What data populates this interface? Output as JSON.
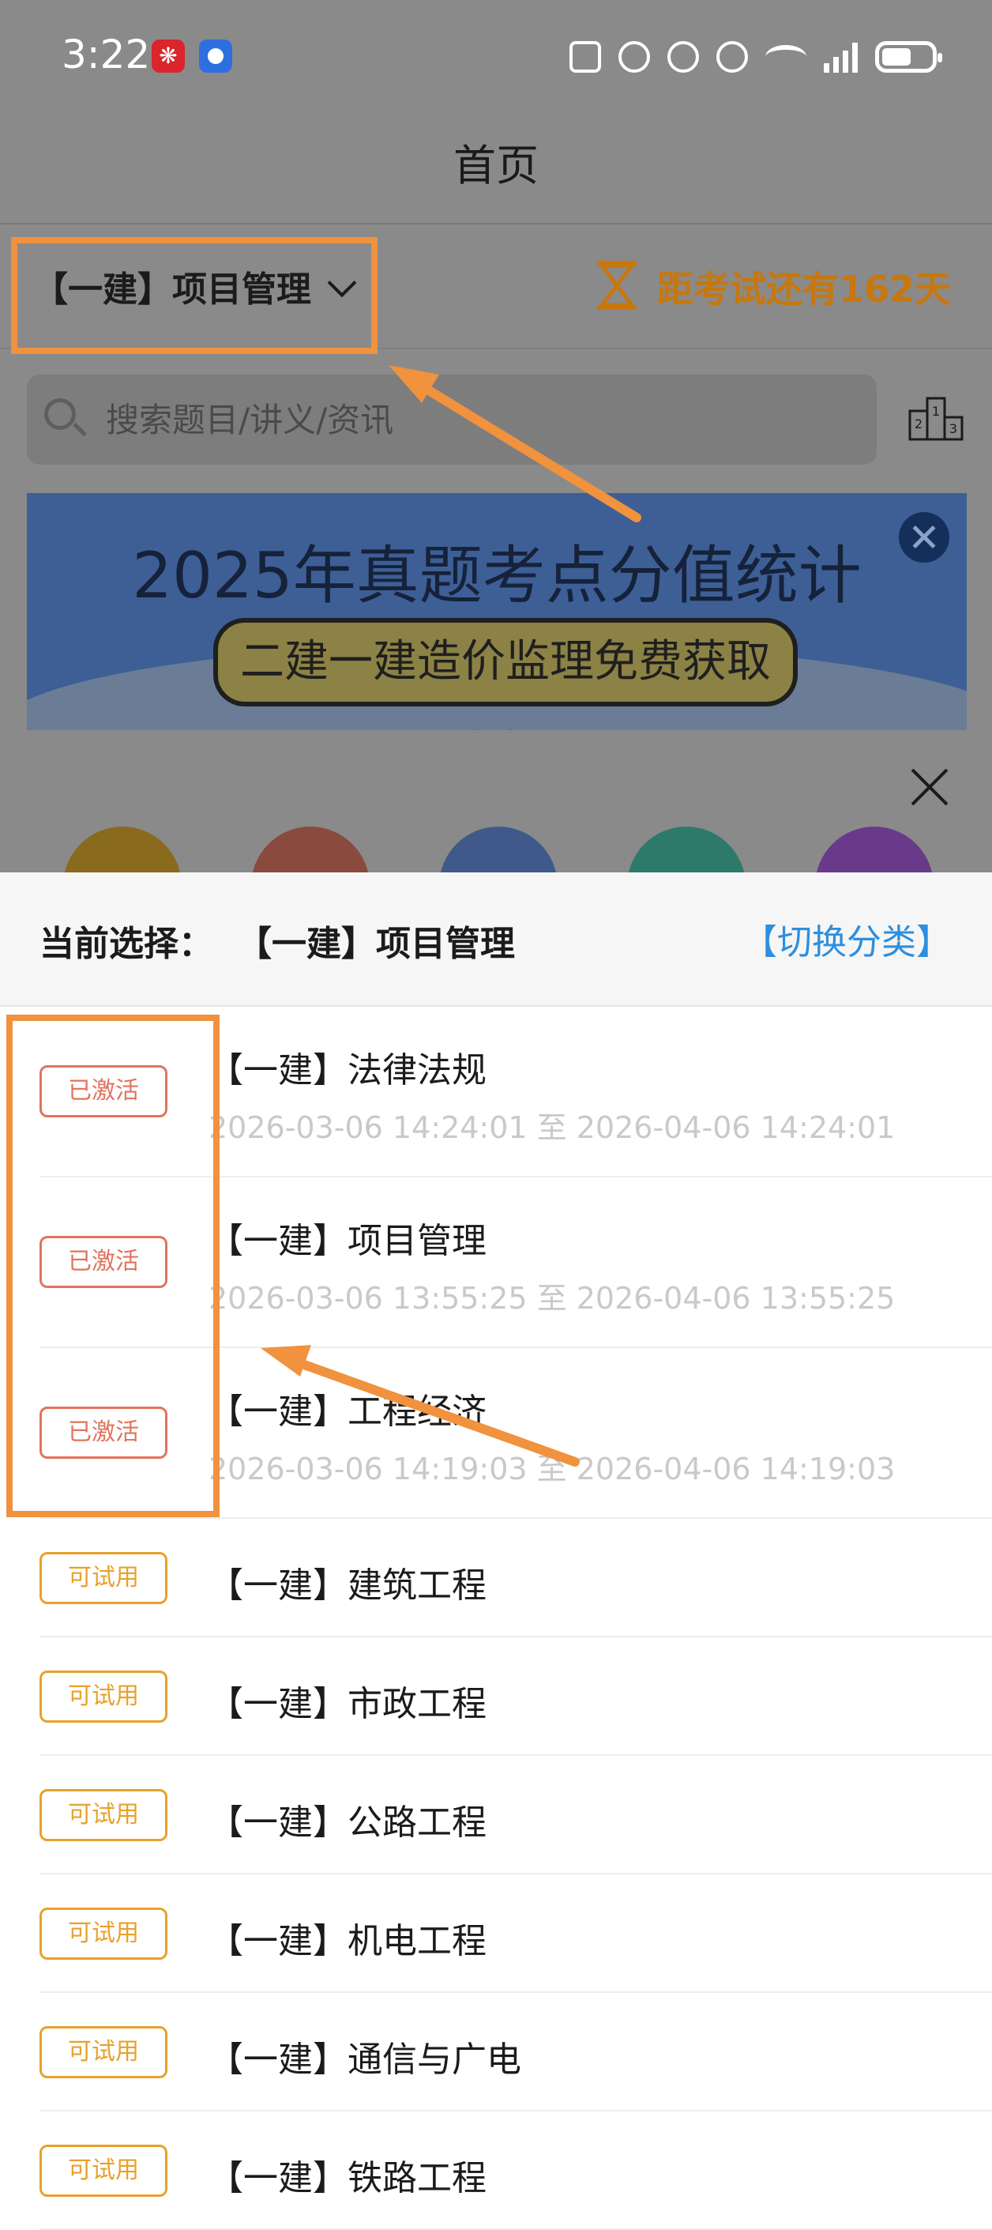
{
  "status_bar": {
    "time": "3:22"
  },
  "nav": {
    "title": "首页"
  },
  "subject_selector": {
    "label": "【一建】项目管理",
    "countdown": "距考试还有162天"
  },
  "search": {
    "placeholder": "搜索题目/讲义/资讯"
  },
  "banner": {
    "title": "2025年真题考点分值统计",
    "subtitle": "二建一建造价监理免费获取>>"
  },
  "sheet": {
    "current_label": "当前选择：",
    "current_value": "【一建】项目管理",
    "switch_label": "【切换分类】",
    "items": [
      {
        "badge": "已激活",
        "badge_type": "active",
        "title": "【一建】法律法规",
        "period": "2026-03-06 14:24:01 至 2026-04-06 14:24:01"
      },
      {
        "badge": "已激活",
        "badge_type": "active",
        "title": "【一建】项目管理",
        "period": "2026-03-06 13:55:25 至 2026-04-06 13:55:25"
      },
      {
        "badge": "已激活",
        "badge_type": "active",
        "title": "【一建】工程经济",
        "period": "2026-03-06 14:19:03 至 2026-04-06 14:19:03"
      },
      {
        "badge": "可试用",
        "badge_type": "trial",
        "title": "【一建】建筑工程"
      },
      {
        "badge": "可试用",
        "badge_type": "trial",
        "title": "【一建】市政工程"
      },
      {
        "badge": "可试用",
        "badge_type": "trial",
        "title": "【一建】公路工程"
      },
      {
        "badge": "可试用",
        "badge_type": "trial",
        "title": "【一建】机电工程"
      },
      {
        "badge": "可试用",
        "badge_type": "trial",
        "title": "【一建】通信与广电"
      },
      {
        "badge": "可试用",
        "badge_type": "trial",
        "title": "【一建】铁路工程"
      }
    ]
  },
  "colors": {
    "highlight_orange": "#f0923e",
    "active_badge": "#e2735c",
    "trial_badge": "#e8a12a",
    "link_blue": "#2c8fe0",
    "countdown": "#c8770d"
  }
}
